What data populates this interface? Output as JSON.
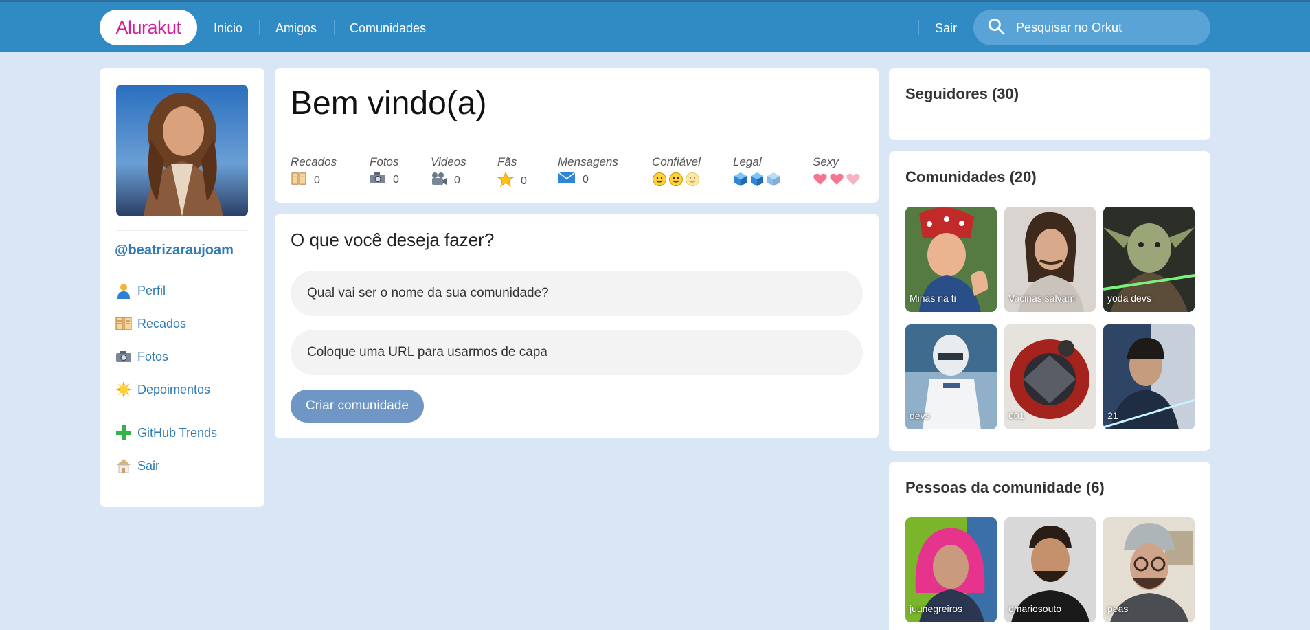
{
  "topbar": {
    "logo": "Alurakut",
    "nav": [
      "Inicio",
      "Amigos",
      "Comunidades"
    ],
    "logout": "Sair",
    "search_placeholder": "Pesquisar no Orkut"
  },
  "profile": {
    "username": "@beatrizaraujoam",
    "menu": [
      {
        "label": "Perfil",
        "icon": "user-icon"
      },
      {
        "label": "Recados",
        "icon": "book-icon"
      },
      {
        "label": "Fotos",
        "icon": "camera-icon"
      },
      {
        "label": "Depoimentos",
        "icon": "sun-icon"
      }
    ],
    "menu2": [
      {
        "label": "GitHub Trends",
        "icon": "plus-icon"
      },
      {
        "label": "Sair",
        "icon": "house-icon"
      }
    ]
  },
  "welcome": {
    "title": "Bem vindo(a)",
    "stats": [
      {
        "label": "Recados",
        "value": "0",
        "icon": "book-icon"
      },
      {
        "label": "Fotos",
        "value": "0",
        "icon": "camera-icon"
      },
      {
        "label": "Videos",
        "value": "0",
        "icon": "video-camera-icon"
      },
      {
        "label": "Fãs",
        "value": "0",
        "icon": "star-icon"
      },
      {
        "label": "Mensagens",
        "value": "0",
        "icon": "envelope-icon"
      }
    ],
    "ratings": [
      {
        "label": "Confiável",
        "icon": "smiley-icon"
      },
      {
        "label": "Legal",
        "icon": "cube-icon"
      },
      {
        "label": "Sexy",
        "icon": "heart-icon"
      }
    ]
  },
  "form": {
    "title": "O que você deseja fazer?",
    "name_placeholder": "Qual vai ser o nome da sua comunidade?",
    "url_placeholder": "Coloque uma URL para usarmos de capa",
    "submit": "Criar comunidade"
  },
  "followers": {
    "title": "Seguidores (30)"
  },
  "communities": {
    "title": "Comunidades (20)",
    "items": [
      "Minas na ti",
      "Vacinas salvam",
      "yoda devs",
      "devs",
      "001",
      "21"
    ]
  },
  "people": {
    "title": "Pessoas da comunidade (6)",
    "items": [
      "juunegreiros",
      "omariosouto",
      "peas"
    ]
  },
  "colors": {
    "topbar": "#308bc5",
    "background": "#d9e6f6",
    "link": "#2e7bb6",
    "logo": "#d81d99",
    "button": "#6f96c5"
  }
}
